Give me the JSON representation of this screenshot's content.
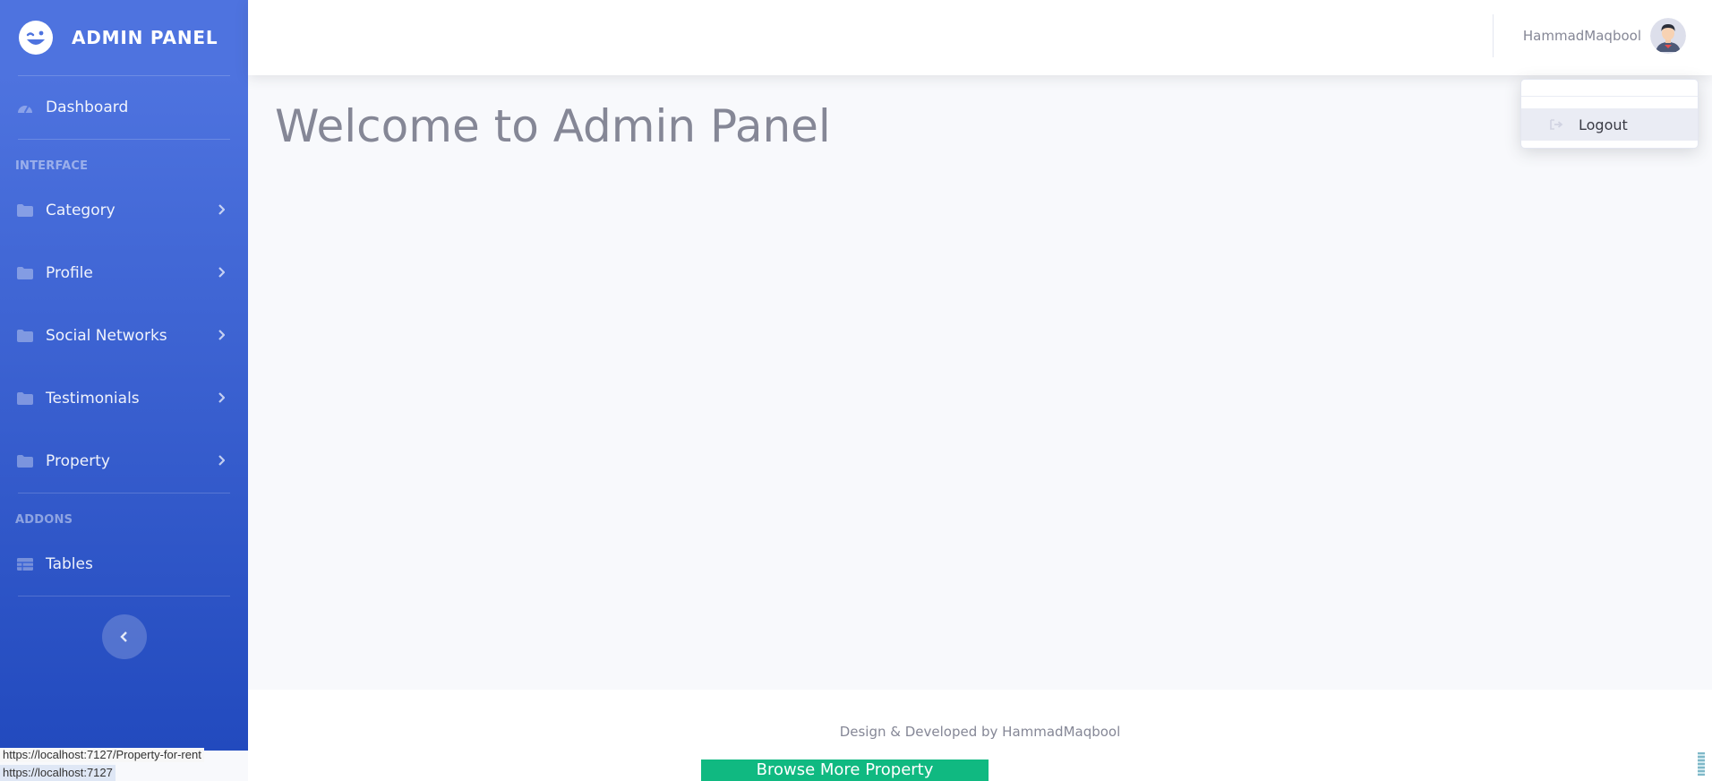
{
  "brand": {
    "title": "ADMIN PANEL",
    "icon": "laugh-wink-icon"
  },
  "sidebar": {
    "dashboard": {
      "label": "Dashboard",
      "icon": "tachometer-icon"
    },
    "interface_heading": "INTERFACE",
    "items": [
      {
        "label": "Category",
        "icon": "folder-icon"
      },
      {
        "label": "Profile",
        "icon": "folder-icon"
      },
      {
        "label": "Social Networks",
        "icon": "folder-icon"
      },
      {
        "label": "Testimonials",
        "icon": "folder-icon"
      },
      {
        "label": "Property",
        "icon": "folder-icon"
      }
    ],
    "addons_heading": "ADDONS",
    "tables": {
      "label": "Tables",
      "icon": "table-icon"
    },
    "toggle_icon": "chevron-left-icon"
  },
  "topbar": {
    "user_name": "HammadMaqbool",
    "avatar": "user-avatar"
  },
  "dropdown": {
    "logout_label": "Logout",
    "logout_icon": "sign-out-icon"
  },
  "main": {
    "title": "Welcome to Admin Panel"
  },
  "footer": {
    "text": "Design & Developed by HammadMaqbool"
  },
  "overlay": {
    "browse_button": "Browse More Property",
    "status_url_1": "https://localhost:7127/Property-for-rent",
    "status_url_2": "https://localhost:7127"
  },
  "colors": {
    "sidebar_top": "#4e73df",
    "sidebar_bottom": "#224abe",
    "page_bg": "#f8f9fc",
    "text_muted": "#858796",
    "browse_button": "#10b981"
  }
}
